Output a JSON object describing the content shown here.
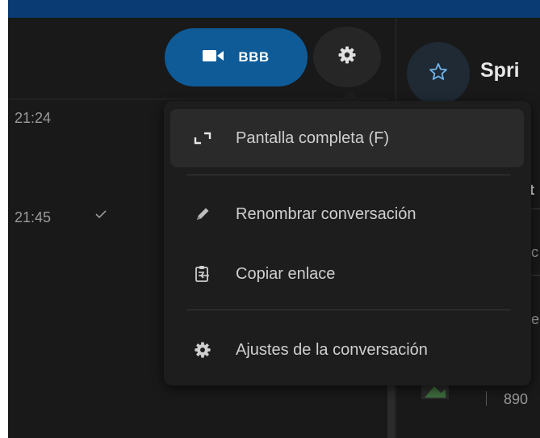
{
  "header": {
    "call_button_label": "BBB",
    "conversation_title": "Spri"
  },
  "messages": [
    {
      "time": "21:24"
    },
    {
      "time": "21:45"
    }
  ],
  "menu": {
    "items": [
      {
        "label": "Pantalla completa (F)",
        "icon": "fullscreen-icon"
      },
      {
        "label": "Renombrar conversación",
        "icon": "pencil-icon"
      },
      {
        "label": "Copiar enlace",
        "icon": "copy-link-icon"
      },
      {
        "label": "Ajustes de la conversación",
        "icon": "gear-icon"
      }
    ]
  },
  "right_panel": {
    "fragments": [
      "t",
      "c",
      "e",
      "890"
    ]
  },
  "colors": {
    "accent_blue": "#0e5b97",
    "top_bar": "#0b3b73",
    "background": "#191919",
    "menu_background": "#1d1d1d",
    "active_item": "#2a2a2a"
  }
}
